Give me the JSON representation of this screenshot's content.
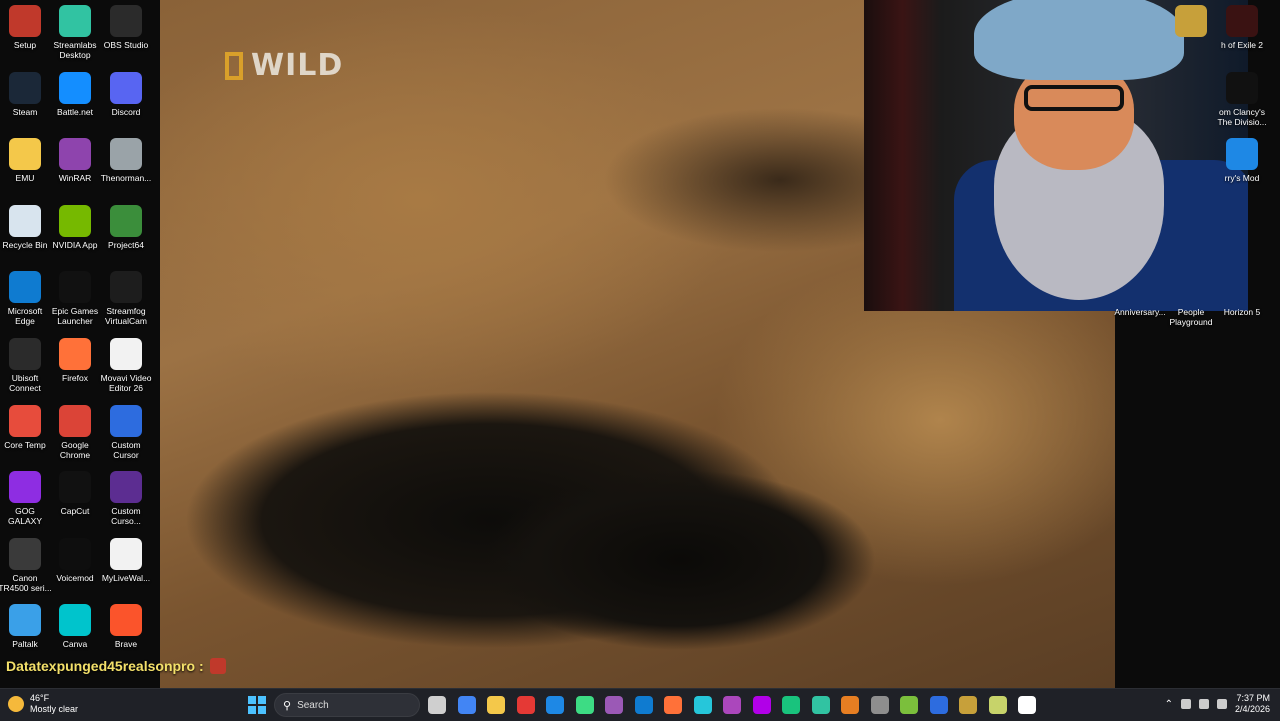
{
  "video": {
    "logo_text": "WILD"
  },
  "desktop_icons": [
    {
      "label": "Setup",
      "icon": "wolf-icon",
      "color": "#c0392b"
    },
    {
      "label": "Streamlabs Desktop",
      "icon": "streamlabs-icon",
      "color": "#31c3a2"
    },
    {
      "label": "OBS Studio",
      "icon": "obs-icon",
      "color": "#2b2b2b"
    },
    {
      "label": "Steam",
      "icon": "steam-icon",
      "color": "#1b2838"
    },
    {
      "label": "Battle.net",
      "icon": "battlenet-icon",
      "color": "#148eff"
    },
    {
      "label": "Discord",
      "icon": "discord-icon",
      "color": "#5865f2"
    },
    {
      "label": "EMU",
      "icon": "folder-icon",
      "color": "#f4c84a"
    },
    {
      "label": "WinRAR",
      "icon": "winrar-icon",
      "color": "#8e44ad"
    },
    {
      "label": "Thenorman...",
      "icon": "thenorman-icon",
      "color": "#9aa3a8"
    },
    {
      "label": "Recycle Bin",
      "icon": "recycle-bin-icon",
      "color": "#d8e4ee"
    },
    {
      "label": "NVIDIA App",
      "icon": "nvidia-icon",
      "color": "#76b900"
    },
    {
      "label": "Project64",
      "icon": "project64-icon",
      "color": "#3b8e3b"
    },
    {
      "label": "Microsoft Edge",
      "icon": "edge-icon",
      "color": "#0f7bd0"
    },
    {
      "label": "Epic Games Launcher",
      "icon": "epic-games-icon",
      "color": "#111111"
    },
    {
      "label": "Streamfog VirtualCam",
      "icon": "streamfog-icon",
      "color": "#1d1d1d"
    },
    {
      "label": "Ubisoft Connect",
      "icon": "ubisoft-icon",
      "color": "#2b2b2b"
    },
    {
      "label": "Firefox",
      "icon": "firefox-icon",
      "color": "#ff7139"
    },
    {
      "label": "Movavi Video Editor 26",
      "icon": "file-icon",
      "color": "#f2f2f2"
    },
    {
      "label": "Core Temp",
      "icon": "thermometer-icon",
      "color": "#e74c3c"
    },
    {
      "label": "Google Chrome",
      "icon": "chrome-icon",
      "color": "#db4437"
    },
    {
      "label": "Custom Cursor",
      "icon": "cursor-icon",
      "color": "#2d6cdf"
    },
    {
      "label": "GOG GALAXY",
      "icon": "gog-icon",
      "color": "#8e2de2"
    },
    {
      "label": "CapCut",
      "icon": "capcut-icon",
      "color": "#111111"
    },
    {
      "label": "Custom Curso...",
      "icon": "firefox-custom-icon",
      "color": "#5c2d91"
    },
    {
      "label": "Canon TR4500 seri...",
      "icon": "canon-icon",
      "color": "#3a3a3a"
    },
    {
      "label": "Voicemod",
      "icon": "voicemod-icon",
      "color": "#0e0e0e"
    },
    {
      "label": "MyLiveWal...",
      "icon": "file-icon",
      "color": "#f2f2f2"
    },
    {
      "label": "Paltalk",
      "icon": "paltalk-icon",
      "color": "#3aa0e8"
    },
    {
      "label": "Canva",
      "icon": "canva-icon",
      "color": "#00c4cc"
    },
    {
      "label": "Brave",
      "icon": "brave-icon",
      "color": "#fb542b"
    }
  ],
  "right_icons": [
    {
      "label": "",
      "icon": "fnaf-icon",
      "color": "#c7a03a"
    },
    {
      "label": "h of Exile 2",
      "icon": "poe-icon",
      "color": "#3a1212"
    },
    {
      "label": "om Clancy's The Divisio...",
      "icon": "division-icon",
      "color": "#111111"
    },
    {
      "label": "rry's Mod",
      "icon": "gmod-icon",
      "color": "#1e88e5"
    },
    {
      "label": "Anniversary...",
      "icon": "app-icon",
      "color": "#333333"
    },
    {
      "label": "People Playground",
      "icon": "app-icon",
      "color": "#333333"
    },
    {
      "label": "Horizon 5",
      "icon": "forza-icon",
      "color": "#333333"
    }
  ],
  "chat": {
    "username": "Datatexpunged45realsonpro :"
  },
  "taskbar": {
    "weather_temp": "46°F",
    "weather_desc": "Mostly clear",
    "search_placeholder": "Search",
    "time": "7:37 PM",
    "date": "2/4/2026"
  }
}
